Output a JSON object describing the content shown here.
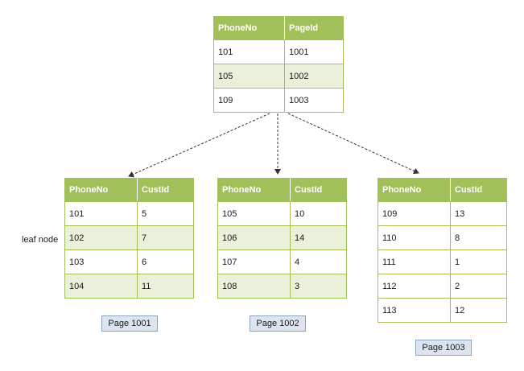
{
  "root": {
    "headers": [
      "PhoneNo",
      "PageId"
    ],
    "rows": [
      [
        "101",
        "1001"
      ],
      [
        "105",
        "1002"
      ],
      [
        "109",
        "1003"
      ]
    ]
  },
  "leaves": [
    {
      "headers": [
        "PhoneNo",
        "CustId"
      ],
      "rows": [
        [
          "101",
          "5"
        ],
        [
          "102",
          "7"
        ],
        [
          "103",
          "6"
        ],
        [
          "104",
          "11"
        ]
      ],
      "page_label": "Page 1001"
    },
    {
      "headers": [
        "PhoneNo",
        "CustId"
      ],
      "rows": [
        [
          "105",
          "10"
        ],
        [
          "106",
          "14"
        ],
        [
          "107",
          "4"
        ],
        [
          "108",
          "3"
        ]
      ],
      "page_label": "Page 1002"
    },
    {
      "headers": [
        "PhoneNo",
        "CustId"
      ],
      "rows": [
        [
          "109",
          "13"
        ],
        [
          "110",
          "8"
        ],
        [
          "111",
          "1"
        ],
        [
          "112",
          "2"
        ],
        [
          "113",
          "12"
        ]
      ],
      "page_label": "Page 1003"
    }
  ],
  "leaf_node_label": "leaf node",
  "colors": {
    "header": "#a2c05a",
    "alt_row": "#eaf0da",
    "page_label_bg": "#dbe4ef"
  }
}
